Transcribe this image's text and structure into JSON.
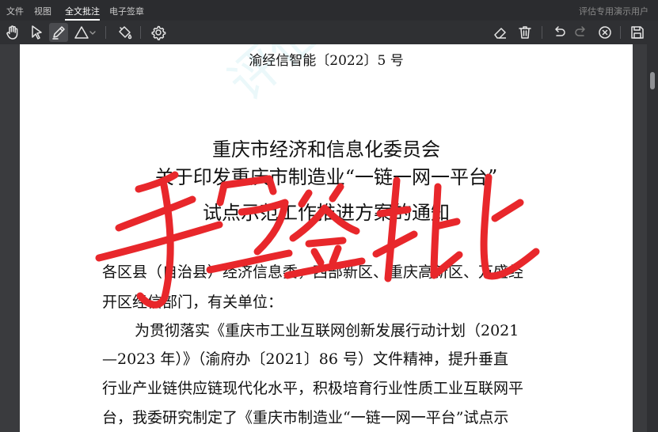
{
  "menubar": {
    "items": [
      "文件",
      "视图",
      "全文批注",
      "电子签章"
    ],
    "active_index": 2,
    "trial_label": "评估专用演示用户"
  },
  "toolbar": {
    "tools": [
      "hand-icon",
      "pointer-icon",
      "pen-icon",
      "triangle-icon",
      "chevron-down-icon",
      "paint-bucket-icon",
      "gear-icon",
      "eraser-icon",
      "trash-icon",
      "undo-icon",
      "redo-icon",
      "close-circle-icon",
      "save-icon"
    ],
    "active_tool": "pen-icon"
  },
  "document": {
    "doc_number": "渝经信智能〔2022〕5 号",
    "title_line1": "重庆市经济和信息化委员会",
    "title_line2": "关于印发重庆市制造业“一链一网一平台”",
    "title_line3": "试点示范工作推进方案的通知",
    "addressee_line1": "各区县（自治县）经济信息委，西部新区、重庆高新区、万盛经",
    "addressee_line2": "开区经信部门，有关单位：",
    "body_lines": [
      "为贯彻落实《重庆市工业互联网创新发展行动计划（2021",
      "—2023 年）》（渝府办〔2021〕86 号）文件精神，提升垂直",
      "行业产业链供应链现代化水平，积极培育行业性质工业互联网平",
      "台，我委研究制定了《重庆市制造业“一链一网一平台”试点示"
    ],
    "watermark": "评估专用演示"
  },
  "annotation": {
    "signature_text": "手写签批",
    "ink_color": "#e8272b"
  },
  "colors": {
    "menubar_bg": "#2b2c2f",
    "toolbar_bg": "#2f3033",
    "canvas_bg": "#3a3b3e"
  }
}
